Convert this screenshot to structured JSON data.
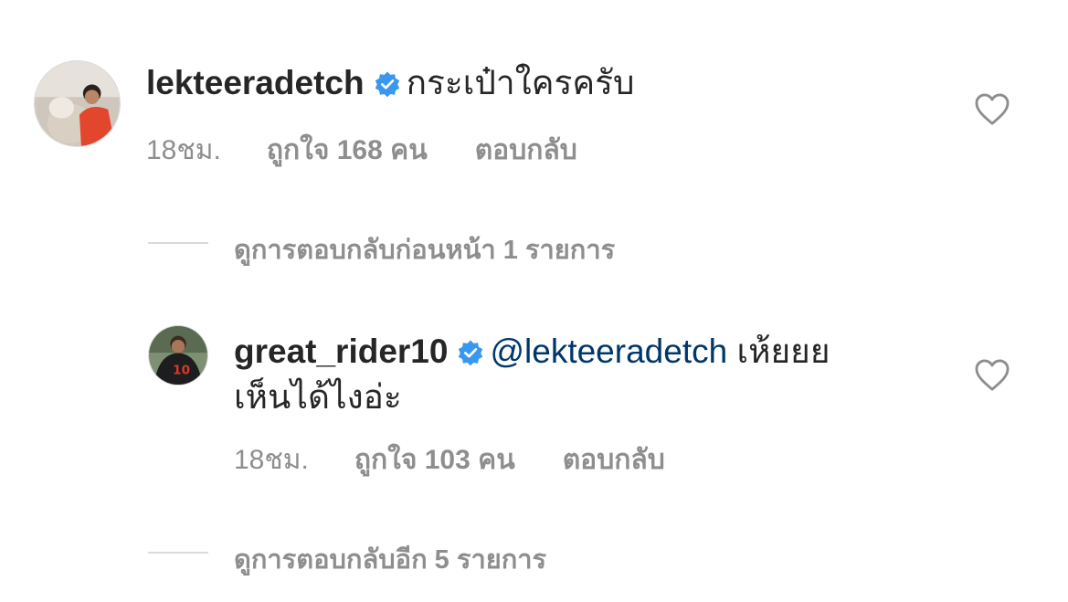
{
  "comment": {
    "username": "lekteeradetch",
    "verified": true,
    "text": "กระเป๋าใครครับ",
    "time": "18ชม.",
    "likes": "ถูกใจ 168 คน",
    "reply_label": "ตอบกลับ",
    "avatar_icon": "profile-photo-man-with-dog"
  },
  "view_previous_replies": "ดูการตอบกลับก่อนหน้า 1 รายการ",
  "reply": {
    "username": "great_rider10",
    "verified": true,
    "mention": "@lekteeradetch",
    "text_line1": "เห้ยยย",
    "text_line2": "เห็นได้ไงอ่ะ",
    "time": "18ชม.",
    "likes": "ถูกใจ 103 คน",
    "reply_label": "ตอบกลับ",
    "avatar_icon": "profile-photo-soccer-player-number-10"
  },
  "view_more_replies": "ดูการตอบกลับอีก 5 รายการ",
  "colors": {
    "verified_badge": "#3897f0",
    "mention": "#00376b",
    "meta_text": "#8e8e8e",
    "divider": "#dbdbdb"
  }
}
